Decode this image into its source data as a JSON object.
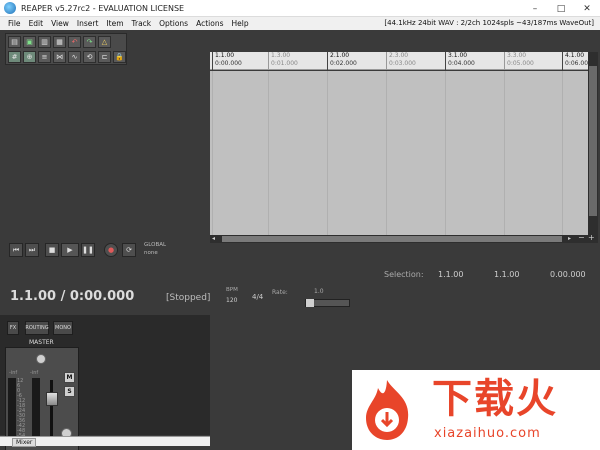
{
  "window": {
    "title": "REAPER v5.27rc2 - EVALUATION LICENSE",
    "minimize_glyph": "–",
    "maximize_glyph": "□",
    "close_glyph": "✕"
  },
  "menu": {
    "items": [
      "File",
      "Edit",
      "View",
      "Insert",
      "Item",
      "Track",
      "Options",
      "Actions",
      "Help"
    ],
    "status_info": "[44.1kHz 24bit WAV : 2/2ch 1024spls ~43/187ms WaveOut]"
  },
  "ruler": {
    "marks": [
      {
        "bar": "1.1.00",
        "time": "0:00.000",
        "major": true
      },
      {
        "bar": "1.3.00",
        "time": "0:01.000",
        "major": false
      },
      {
        "bar": "2.1.00",
        "time": "0:02.000",
        "major": true
      },
      {
        "bar": "2.3.00",
        "time": "0:03.000",
        "major": false
      },
      {
        "bar": "3.1.00",
        "time": "0:04.000",
        "major": true
      },
      {
        "bar": "3.3.00",
        "time": "0:05.000",
        "major": false
      },
      {
        "bar": "4.1.00",
        "time": "0:06.000",
        "major": true
      }
    ]
  },
  "transport": {
    "global_label": "GLOBAL",
    "none_label": "none",
    "selection_label": "Selection:",
    "selection_start": "1.1.00",
    "selection_end": "1.1.00",
    "selection_length": "0.00.000",
    "position": "1.1.00 / 0:00.000",
    "state": "[Stopped]",
    "bpm_label": "BPM",
    "bpm": "120",
    "time_signature": "4/4",
    "rate_label": "Rate:",
    "rate": "1.0"
  },
  "mixer": {
    "fx_label": "FX",
    "routing_label": "ROUTING",
    "mono_label": "MONO",
    "master_label": "MASTER",
    "mute_label": "M",
    "solo_label": "S",
    "meter_left_top": "-inf",
    "meter_right_top": "-inf",
    "scale": [
      "12",
      "6",
      "0",
      "-6",
      "-12",
      "-18",
      "-24",
      "-30",
      "-36",
      "-42",
      "-48",
      "-54"
    ],
    "tab_label": "Mixer"
  },
  "watermark": {
    "title": "下载火",
    "url": "xiazaihuo.com"
  },
  "colors": {
    "accent_green": "#7fe08a",
    "record_red": "#e05a5a",
    "watermark_red": "#e8452a"
  }
}
